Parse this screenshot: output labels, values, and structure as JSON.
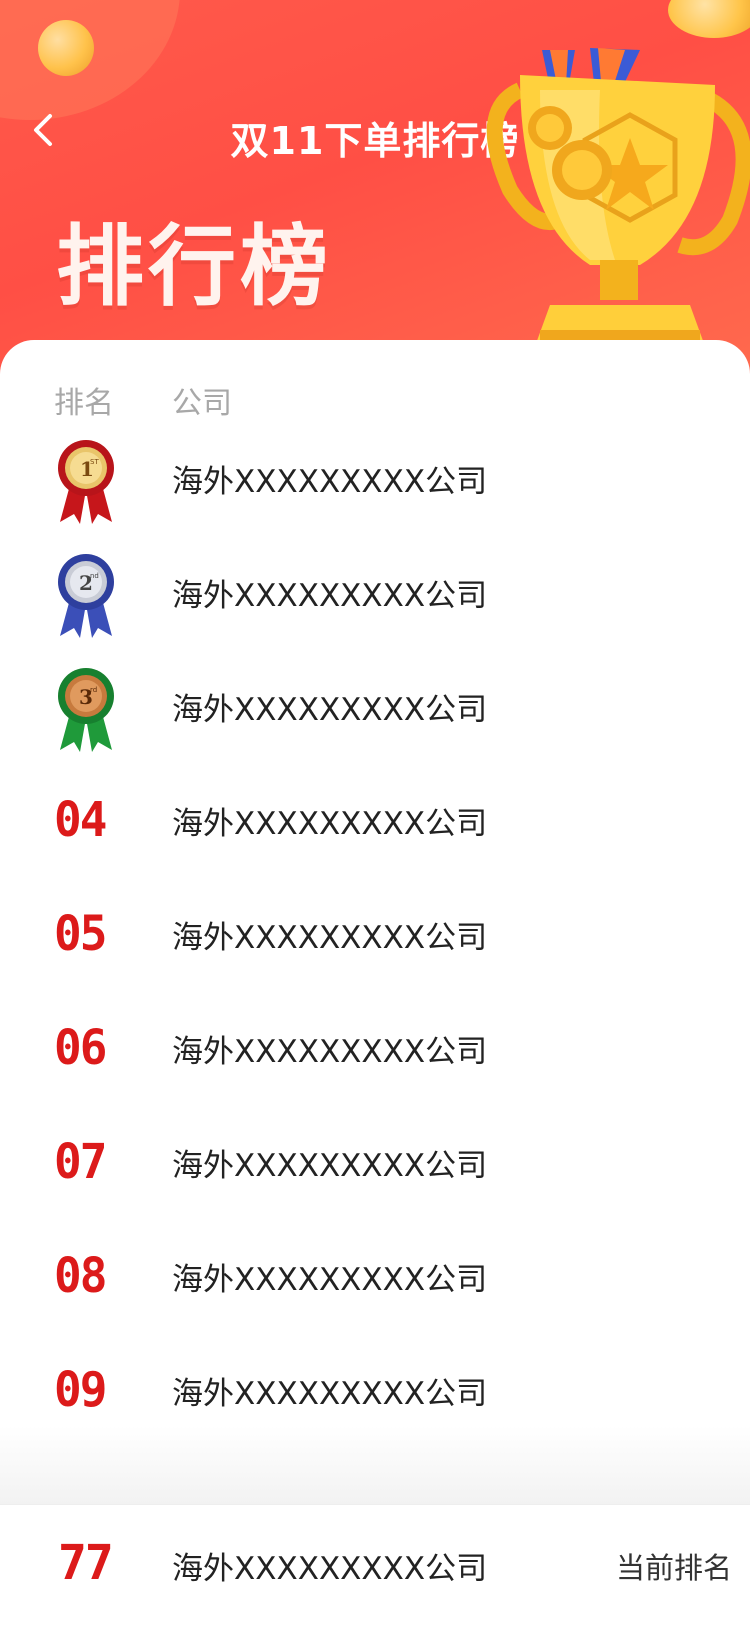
{
  "header": {
    "back_icon": "chevron-left-icon",
    "title": "双11下单排行榜",
    "banner_title": "排行榜"
  },
  "table": {
    "rank_header": "排名",
    "company_header": "公司"
  },
  "rows": [
    {
      "rank": "1",
      "badge": "gold-medal-icon",
      "company": "海外XXXXXXXXX公司"
    },
    {
      "rank": "2",
      "badge": "silver-medal-icon",
      "company": "海外XXXXXXXXX公司"
    },
    {
      "rank": "3",
      "badge": "bronze-medal-icon",
      "company": "海外XXXXXXXXX公司"
    },
    {
      "rank": "04",
      "company": "海外XXXXXXXXX公司"
    },
    {
      "rank": "05",
      "company": "海外XXXXXXXXX公司"
    },
    {
      "rank": "06",
      "company": "海外XXXXXXXXX公司"
    },
    {
      "rank": "07",
      "company": "海外XXXXXXXXX公司"
    },
    {
      "rank": "08",
      "company": "海外XXXXXXXXX公司"
    },
    {
      "rank": "09",
      "company": "海外XXXXXXXXX公司"
    }
  ],
  "current": {
    "rank": "77",
    "company": "海外XXXXXXXXX公司",
    "label": "当前排名"
  },
  "colors": {
    "header_red": "#ff4f45",
    "rank_red": "#dc1a1a",
    "gold": "#ffd24a"
  }
}
